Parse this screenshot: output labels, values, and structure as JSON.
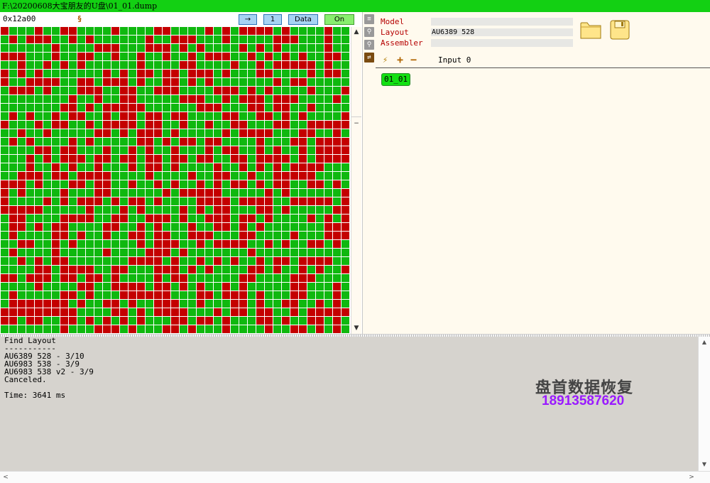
{
  "window": {
    "title": "F:\\20200608大宝朋友的U盘\\01_01.dump"
  },
  "toolbar": {
    "address": "0x12a00",
    "icon": "link-icon",
    "arrow_label": "→",
    "page_label": "1",
    "data_label": "Data",
    "on_label": "On"
  },
  "grid": {
    "cols": 41,
    "rows": 36,
    "colors": {
      "on": "#0fb80f",
      "off": "#c40000",
      "gridline": "#ffffff"
    }
  },
  "scroll": {
    "up": "▲",
    "minus": "−",
    "down": "▼"
  },
  "side": {
    "list_icon": "≡",
    "pin1_icon": "⚲",
    "pin2_icon": "⚲",
    "swap_icon": "⇄"
  },
  "info": {
    "model_label": "Model",
    "model_value": "",
    "layout_label": "Layout",
    "layout_value": "AU6389 528",
    "assembler_label": "Assembler",
    "assembler_value": ""
  },
  "subtoolbar": {
    "wand": "⚡",
    "plus": "+",
    "minus": "−",
    "input_label": "Input 0"
  },
  "chip": {
    "label": "01_01"
  },
  "log": {
    "lines": [
      "Find Layout",
      "-----------",
      "AU6389 528 - 3/10",
      "AU6983 538 - 3/9",
      "AU6983 538 v2 - 3/9",
      "Canceled.",
      "",
      "Time: 3641 ms"
    ]
  },
  "log_scroll": {
    "up": "▲",
    "down": "▼",
    "left": "<",
    "right": ">"
  },
  "watermark": {
    "name": "盘首数据恢复",
    "phone": "18913587620"
  },
  "colors": {
    "title_bar": "#13d013",
    "accent_red": "#b50000",
    "chip_green": "#13e013",
    "watermark_purple": "#9a1aff"
  }
}
